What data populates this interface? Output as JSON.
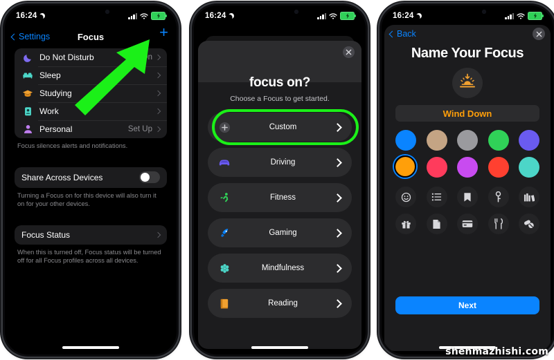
{
  "watermark": "shenmazhishi.com",
  "status_bar": {
    "time": "16:24",
    "moon_icon": "crescent-moon-icon",
    "signal_icon": "cellular-bars-icon",
    "wifi_icon": "wifi-icon",
    "battery_icon": "battery-charging-icon"
  },
  "phone1": {
    "nav": {
      "back_label": "Settings",
      "title": "Focus",
      "add_label": "+"
    },
    "focus_list": [
      {
        "label": "Do Not Disturb",
        "value": "On",
        "icon": "moon-icon",
        "color": "#7e6bf0"
      },
      {
        "label": "Sleep",
        "value": "",
        "icon": "bed-icon",
        "color": "#4cd6c8"
      },
      {
        "label": "Studying",
        "value": "",
        "icon": "graduation-cap-icon",
        "color": "#f0a030"
      },
      {
        "label": "Work",
        "value": "",
        "icon": "badge-icon",
        "color": "#4cd6c8"
      },
      {
        "label": "Personal",
        "value": "Set Up",
        "icon": "person-icon",
        "color": "#c07ef0"
      }
    ],
    "focus_footer": "Focus silences alerts and notifications.",
    "share_row": {
      "label": "Share Across Devices",
      "toggle_on": false
    },
    "share_footer": "Turning a Focus on for this device will also turn it on for your other devices.",
    "status_row": {
      "label": "Focus Status"
    },
    "status_footer": "When this is turned off, Focus status will be turned off for all Focus profiles across all devices."
  },
  "phone2": {
    "close_label": "close-icon",
    "title": "focus on?",
    "subtitle": "Choose a Focus to get started.",
    "options": [
      {
        "label": "Custom",
        "icon": "plus-circle-icon",
        "color": "#8e8e93",
        "highlighted": true
      },
      {
        "label": "Driving",
        "icon": "car-icon",
        "color": "#6a5bf0"
      },
      {
        "label": "Fitness",
        "icon": "running-person-icon",
        "color": "#30d158"
      },
      {
        "label": "Gaming",
        "icon": "rocket-icon",
        "color": "#0a84ff"
      },
      {
        "label": "Mindfulness",
        "icon": "flower-icon",
        "color": "#4cd6c8"
      },
      {
        "label": "Reading",
        "icon": "book-icon",
        "color": "#f0a030"
      }
    ]
  },
  "phone3": {
    "back_label": "Back",
    "close_label": "close-icon",
    "title": "Name Your Focus",
    "avatar_icon": "sunset-icon",
    "avatar_color": "#f0a030",
    "name_value": "Wind Down",
    "colors_row1": [
      "#0a84ff",
      "#c4a484",
      "#9a9a9e",
      "#30d158",
      "#6a5bf0"
    ],
    "colors_row2": [
      "#ff9f0a",
      "#ff3b5c",
      "#c martinez",
      "#ff4030",
      "#4cd6c8"
    ],
    "swatches": [
      {
        "hex": "#0a84ff",
        "selected": false
      },
      {
        "hex": "#c4a484",
        "selected": false
      },
      {
        "hex": "#9a9a9e",
        "selected": false
      },
      {
        "hex": "#30d158",
        "selected": false
      },
      {
        "hex": "#6a5bf0",
        "selected": false
      },
      {
        "hex": "#ff9f0a",
        "selected": true
      },
      {
        "hex": "#ff3b5c",
        "selected": false
      },
      {
        "hex": "#c84bf0",
        "selected": false
      },
      {
        "hex": "#ff4030",
        "selected": false
      },
      {
        "hex": "#4cd6c8",
        "selected": false
      }
    ],
    "icons": [
      "smiley-icon",
      "list-icon",
      "bookmark-icon",
      "key-icon",
      "books-icon",
      "gift-icon",
      "document-icon",
      "credit-card-icon",
      "utensils-icon",
      "pills-icon"
    ],
    "next_label": "Next"
  }
}
